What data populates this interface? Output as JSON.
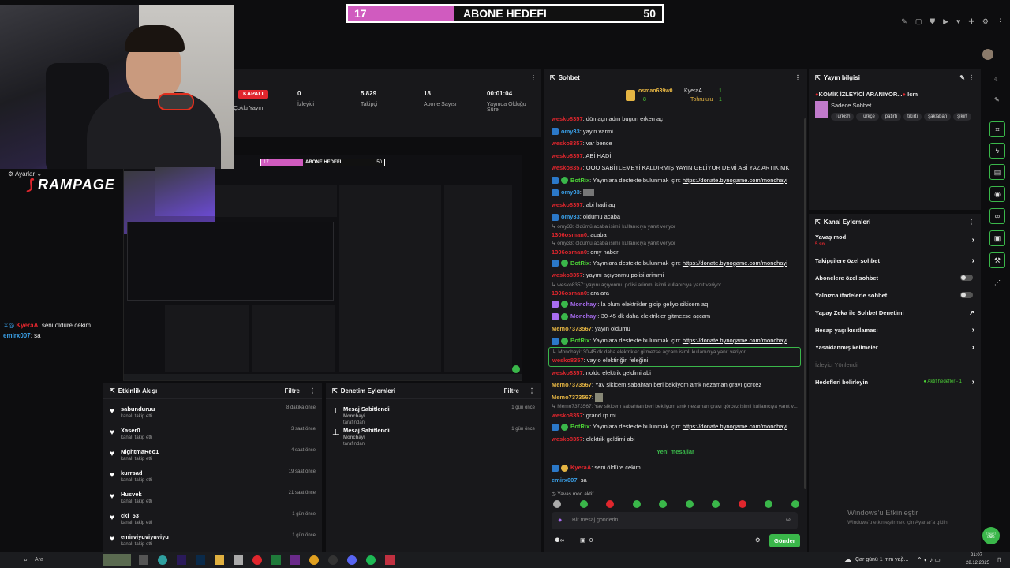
{
  "goal": {
    "left": "17",
    "title": "ABONE HEDEFI",
    "right": "50",
    "progress": 0.34
  },
  "overlay": {
    "settings_label": "Ayarlar",
    "brand": "RAMPAGE"
  },
  "overlay_chat": [
    {
      "user": "KyeraA",
      "text": ": seni öldüre cekim"
    },
    {
      "user": "emirx007",
      "text": ": sa"
    }
  ],
  "stats": {
    "status": "KAPALI",
    "multistream": "Çoklu Yayın",
    "viewers_value": "0",
    "viewers_label": "İzleyici",
    "followers_value": "5.829",
    "followers_label": "Takipçi",
    "subs_value": "18",
    "subs_label": "Abone Sayısı",
    "duration_value": "00:01:04",
    "duration_label": "Yayında Olduğu Süre"
  },
  "preview": {
    "goal_left": "17",
    "goal_title": "ABONE HEDEFI",
    "goal_right": "50"
  },
  "activity": {
    "title": "Etkinlik Akışı",
    "filter": "Filtre",
    "items": [
      {
        "name": "sabunduruu",
        "desc": "kanalı takip etti",
        "time": "8 dakika önce"
      },
      {
        "name": "Xaser0",
        "desc": "kanalı takip etti",
        "time": "3 saat önce"
      },
      {
        "name": "NightmaReo1",
        "desc": "kanalı takip etti",
        "time": "4 saat önce"
      },
      {
        "name": "kurrsad",
        "desc": "kanalı takip etti",
        "time": "19 saat önce"
      },
      {
        "name": "Husvek",
        "desc": "kanalı takip etti",
        "time": "21 saat önce"
      },
      {
        "name": "cki_53",
        "desc": "kanalı takip etti",
        "time": "1 gün önce"
      },
      {
        "name": "emirviyuviyuviyu",
        "desc": "kanalı takip etti",
        "time": "1 gün önce"
      }
    ]
  },
  "moderation": {
    "title": "Denetim Eylemleri",
    "filter": "Filtre",
    "items": [
      {
        "title": "Mesaj Sabitlendi",
        "by": "Monchayi",
        "suffix": "tarafından",
        "time": "1 gün önce"
      },
      {
        "title": "Mesaj Sabitlendi",
        "by": "Monchayi",
        "suffix": "tarafından",
        "time": "1 gün önce"
      }
    ]
  },
  "chat": {
    "title": "Sohbet",
    "top_users": [
      {
        "name": "osman639w0",
        "count": "8"
      },
      {
        "name": "KyeraA",
        "count": "1"
      },
      {
        "name": "Tohruluiu",
        "count": "1"
      }
    ],
    "donate_link": "https://donate.bynogame.com/monchayi",
    "messages": [
      {
        "user": "wesko8357",
        "text": ": dün açmadın bugun erken aç",
        "color": "red"
      },
      {
        "user": "omy33",
        "text": ": yayin varmi",
        "color": "blu"
      },
      {
        "user": "wesko8357",
        "text": ": var bence",
        "color": "red"
      },
      {
        "user": "wesko8357",
        "text": ": ABİ HADİ",
        "color": "red"
      },
      {
        "user": "wesko8357",
        "text": ": OOO SABİTLEMEYİ KALDIRMIŞ YAYIN GELİYOR DEMİ ABİ YAZ ARTIK MK",
        "color": "red"
      },
      {
        "user": "BotRix",
        "text": ": Yayınlara destekte bulunmak için:",
        "color": "grn"
      },
      {
        "user": "omy33",
        "text": ":",
        "color": "blu"
      },
      {
        "user": "wesko8357",
        "text": ": abi hadi aq",
        "color": "red"
      },
      {
        "user": "omy33",
        "text": ": öldümü acaba",
        "color": "blu"
      },
      {
        "user": "",
        "text": "omy33: öldümü acaba isimli kullanıcıya yanıt veriyor",
        "color": "gry"
      },
      {
        "user": "1306osman0",
        "text": ": acaba",
        "color": "red"
      },
      {
        "user": "",
        "text": "omy33: öldümü acaba isimli kullanıcıya yanıt veriyor",
        "color": "gry"
      },
      {
        "user": "1306osman0",
        "text": ": omy naber",
        "color": "red"
      },
      {
        "user": "BotRix",
        "text": ": Yayınlara destekte bulunmak için:",
        "color": "grn"
      },
      {
        "user": "wesko8357",
        "text": ": yayını açıyonmu polisi arimmi",
        "color": "red"
      },
      {
        "user": "",
        "text": "wesko8357: yayını açıyonmu polisi arimmi isimli kullanıcıya yanıt veriyor",
        "color": "gry"
      },
      {
        "user": "1306osman0",
        "text": ": ara ara",
        "color": "red"
      },
      {
        "user": "Monchayi",
        "text": ": la olum elektrikler gidip geliyo sikicem aq",
        "color": "pur"
      },
      {
        "user": "Monchayi",
        "text": ": 30-45 dk daha elektrikler gitmezse açcam",
        "color": "pur"
      },
      {
        "user": "Memo7373567",
        "text": ": yayın oldumu",
        "color": "gold"
      },
      {
        "user": "BotRix",
        "text": ": Yayınlara destekte bulunmak için:",
        "color": "grn"
      }
    ],
    "highlight_reply": "Monchayi: 30-45 dk daha elektrikler gitmezse açcam isimli kullanıcıya yanıt veriyor",
    "highlight_msg": {
      "user": "wesko8357",
      "text": ": vay o elektiriğin feleğini"
    },
    "messages2": [
      {
        "user": "wesko8357",
        "text": ": noldu elektrik geldimi abi",
        "color": "red"
      },
      {
        "user": "Memo7373567",
        "text": ": Yav sikicem sabahtan beri bekliyom amk nezaman gravı görcez",
        "color": "gold"
      },
      {
        "user": "Memo7373567",
        "text": ":",
        "color": "gold"
      },
      {
        "user": "",
        "text": "Memo7373567: Yav sikicem sabahtan beri bekliyom amk nezaman gravı görcez isimli kullanıcıya yanıt v...",
        "color": "gry"
      },
      {
        "user": "wesko8357",
        "text": ": grand rp mi",
        "color": "red"
      },
      {
        "user": "BotRix",
        "text": ": Yayınlara destekte bulunmak için:",
        "color": "grn"
      },
      {
        "user": "wesko8357",
        "text": ": elektrik geldimi abi",
        "color": "red"
      }
    ],
    "new_messages": "Yeni mesajlar",
    "messages3": [
      {
        "user": "KyeraA",
        "text": ": seni öldüre cekim",
        "color": "red"
      },
      {
        "user": "emirx007",
        "text": ": sa",
        "color": "blu"
      }
    ],
    "slow_mode": "Yavaş mod aktif",
    "input_placeholder": "Bir mesaj gönderin",
    "users_count": "0",
    "send_label": "Gönder"
  },
  "stream_info": {
    "title": "Yayın bilgisi",
    "stream_title": "KOMİK İZLEYİCİ ARANIYOR...",
    "stream_title_suffix": "lcm",
    "category": "Sadece Sohbet",
    "tags": [
      "Turkish",
      "Türkçe",
      "patırtı",
      "tikırtı",
      "şaklaban",
      "şikırt"
    ]
  },
  "channel_actions": {
    "title": "Kanal Eylemleri",
    "slow_mode": "Yavaş mod",
    "slow_value": "5 sn.",
    "followers_only": "Takipçilere özel sohbet",
    "subs_only": "Abonelere özel sohbet",
    "emotes_only": "Yalnızca ifadelerle sohbet",
    "ai_moderation": "Yapay Zeka ile Sohbet Denetimi",
    "account_age": "Hesap yaşı kısıtlaması",
    "banned_words": "Yasaklanmış kelimeler",
    "manage_viewers": "İzleyici Yönlendir",
    "goals": "Hedefleri belirleyin",
    "goals_status": "Aktif hedefler - 1"
  },
  "windows": {
    "line1": "Windows'u Etkinleştir",
    "line2": "Windows'u etkinleştirmek için Ayarlar'a gidin."
  },
  "taskbar": {
    "search": "Ara",
    "weather": "Çar günü 1 mm yağ...",
    "time": "21:07",
    "date": "28.12.2025"
  },
  "colors": {
    "accent": "#3ab74a",
    "goal": "#d05bbf",
    "live_red": "#e0262d"
  }
}
